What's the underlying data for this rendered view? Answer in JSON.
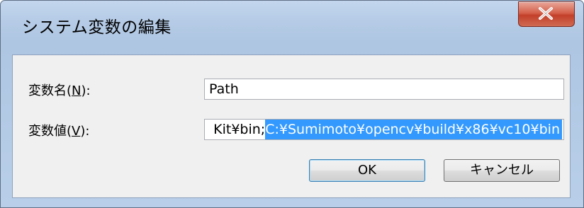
{
  "window": {
    "title": "システム変数の編集",
    "close_icon": "close-icon"
  },
  "form": {
    "name_label_prefix": "変数名(",
    "name_label_key": "N",
    "name_label_suffix": "):",
    "name_value": "Path",
    "value_label_prefix": "変数値(",
    "value_label_key": "V",
    "value_label_suffix": "):",
    "value_text_unselected": "Kit¥bin;",
    "value_text_selected": "C:¥Sumimoto¥opencv¥build¥x86¥vc10¥bin"
  },
  "buttons": {
    "ok_label": "OK",
    "cancel_label": "キャンセル"
  },
  "colors": {
    "selection": "#3399ff",
    "close_button": "#c3402a"
  }
}
